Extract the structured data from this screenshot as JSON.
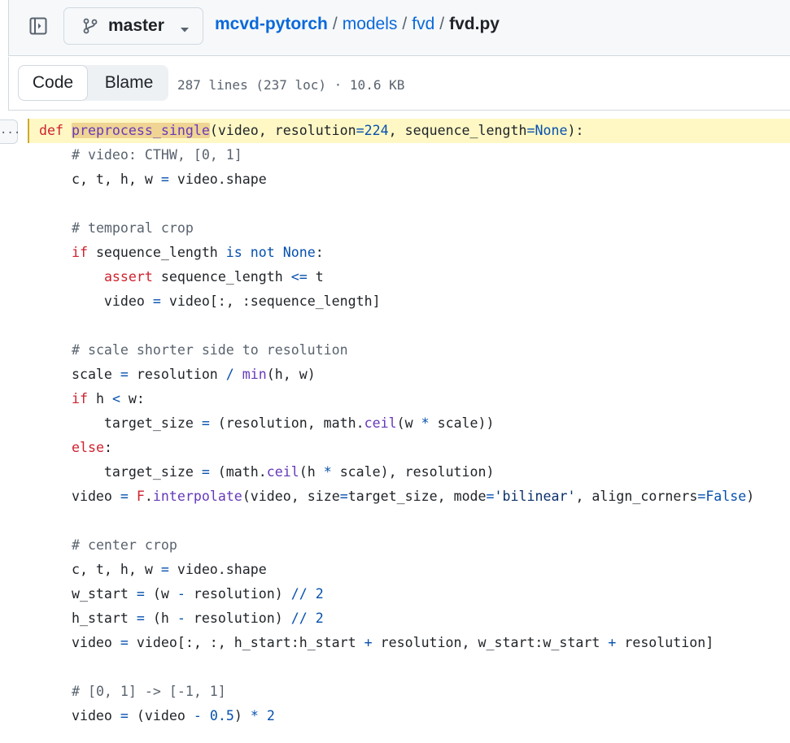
{
  "header": {
    "branch": "master",
    "breadcrumb": {
      "repo": "mcvd-pytorch",
      "dir1": "models",
      "dir2": "fvd",
      "file": "fvd.py",
      "separator": "/"
    }
  },
  "file_header": {
    "tab_code": "Code",
    "tab_blame": "Blame",
    "meta": "287 lines (237 loc) · 10.6 KB"
  },
  "code": {
    "expand_label": "...",
    "lines": [
      [
        {
          "t": "def",
          "c": "kw"
        },
        {
          "t": " "
        },
        {
          "t": "preprocess_single",
          "c": "fn hl-word"
        },
        {
          "t": "(video, resolution"
        },
        {
          "t": "=",
          "c": "nu"
        },
        {
          "t": "224",
          "c": "nu"
        },
        {
          "t": ", sequence_length"
        },
        {
          "t": "=",
          "c": "nu"
        },
        {
          "t": "None",
          "c": "nu"
        },
        {
          "t": "):"
        }
      ],
      [
        {
          "t": "    "
        },
        {
          "t": "# video: CTHW, [0, 1]",
          "c": "cm"
        }
      ],
      [
        {
          "t": "    c, t, h, w "
        },
        {
          "t": "=",
          "c": "nu"
        },
        {
          "t": " video.shape"
        }
      ],
      [
        {
          "t": ""
        }
      ],
      [
        {
          "t": "    "
        },
        {
          "t": "# temporal crop",
          "c": "cm"
        }
      ],
      [
        {
          "t": "    "
        },
        {
          "t": "if",
          "c": "kw"
        },
        {
          "t": " sequence_length "
        },
        {
          "t": "is not",
          "c": "nu"
        },
        {
          "t": " "
        },
        {
          "t": "None",
          "c": "nu"
        },
        {
          "t": ":"
        }
      ],
      [
        {
          "t": "        "
        },
        {
          "t": "assert",
          "c": "kw"
        },
        {
          "t": " sequence_length "
        },
        {
          "t": "<=",
          "c": "nu"
        },
        {
          "t": " t"
        }
      ],
      [
        {
          "t": "        video "
        },
        {
          "t": "=",
          "c": "nu"
        },
        {
          "t": " video[:, :sequence_length]"
        }
      ],
      [
        {
          "t": ""
        }
      ],
      [
        {
          "t": "    "
        },
        {
          "t": "# scale shorter side to resolution",
          "c": "cm"
        }
      ],
      [
        {
          "t": "    scale "
        },
        {
          "t": "=",
          "c": "nu"
        },
        {
          "t": " resolution "
        },
        {
          "t": "/",
          "c": "nu"
        },
        {
          "t": " "
        },
        {
          "t": "min",
          "c": "fn"
        },
        {
          "t": "(h, w)"
        }
      ],
      [
        {
          "t": "    "
        },
        {
          "t": "if",
          "c": "kw"
        },
        {
          "t": " h "
        },
        {
          "t": "<",
          "c": "nu"
        },
        {
          "t": " w:"
        }
      ],
      [
        {
          "t": "        target_size "
        },
        {
          "t": "=",
          "c": "nu"
        },
        {
          "t": " (resolution, math."
        },
        {
          "t": "ceil",
          "c": "fn"
        },
        {
          "t": "(w "
        },
        {
          "t": "*",
          "c": "nu"
        },
        {
          "t": " scale))"
        }
      ],
      [
        {
          "t": "    "
        },
        {
          "t": "else",
          "c": "kw"
        },
        {
          "t": ":"
        }
      ],
      [
        {
          "t": "        target_size "
        },
        {
          "t": "=",
          "c": "nu"
        },
        {
          "t": " (math."
        },
        {
          "t": "ceil",
          "c": "fn"
        },
        {
          "t": "(h "
        },
        {
          "t": "*",
          "c": "nu"
        },
        {
          "t": " scale), resolution)"
        }
      ],
      [
        {
          "t": "    video "
        },
        {
          "t": "=",
          "c": "nu"
        },
        {
          "t": " "
        },
        {
          "t": "F",
          "c": "kw"
        },
        {
          "t": "."
        },
        {
          "t": "interpolate",
          "c": "fn"
        },
        {
          "t": "(video, size"
        },
        {
          "t": "=",
          "c": "nu"
        },
        {
          "t": "target_size, mode"
        },
        {
          "t": "=",
          "c": "nu"
        },
        {
          "t": "'bilinear'",
          "c": "st"
        },
        {
          "t": ", align_corners"
        },
        {
          "t": "=",
          "c": "nu"
        },
        {
          "t": "False",
          "c": "nu"
        },
        {
          "t": ")"
        }
      ],
      [
        {
          "t": ""
        }
      ],
      [
        {
          "t": "    "
        },
        {
          "t": "# center crop",
          "c": "cm"
        }
      ],
      [
        {
          "t": "    c, t, h, w "
        },
        {
          "t": "=",
          "c": "nu"
        },
        {
          "t": " video.shape"
        }
      ],
      [
        {
          "t": "    w_start "
        },
        {
          "t": "=",
          "c": "nu"
        },
        {
          "t": " (w "
        },
        {
          "t": "-",
          "c": "nu"
        },
        {
          "t": " resolution) "
        },
        {
          "t": "//",
          "c": "nu"
        },
        {
          "t": " "
        },
        {
          "t": "2",
          "c": "nu"
        }
      ],
      [
        {
          "t": "    h_start "
        },
        {
          "t": "=",
          "c": "nu"
        },
        {
          "t": " (h "
        },
        {
          "t": "-",
          "c": "nu"
        },
        {
          "t": " resolution) "
        },
        {
          "t": "//",
          "c": "nu"
        },
        {
          "t": " "
        },
        {
          "t": "2",
          "c": "nu"
        }
      ],
      [
        {
          "t": "    video "
        },
        {
          "t": "=",
          "c": "nu"
        },
        {
          "t": " video[:, :, h_start:h_start "
        },
        {
          "t": "+",
          "c": "nu"
        },
        {
          "t": " resolution, w_start:w_start "
        },
        {
          "t": "+",
          "c": "nu"
        },
        {
          "t": " resolution]"
        }
      ],
      [
        {
          "t": ""
        }
      ],
      [
        {
          "t": "    "
        },
        {
          "t": "# [0, 1] -> [-1, 1]",
          "c": "cm"
        }
      ],
      [
        {
          "t": "    video "
        },
        {
          "t": "=",
          "c": "nu"
        },
        {
          "t": " (video "
        },
        {
          "t": "-",
          "c": "nu"
        },
        {
          "t": " "
        },
        {
          "t": "0.5",
          "c": "nu"
        },
        {
          "t": ") "
        },
        {
          "t": "*",
          "c": "nu"
        },
        {
          "t": " "
        },
        {
          "t": "2",
          "c": "nu"
        }
      ]
    ]
  },
  "colors": {
    "link": "#0969da",
    "keyword": "#cf222e",
    "function": "#6639ba",
    "constant": "#0550ae",
    "string": "#0a3069",
    "comment": "#59636e",
    "highlight_line": "#fff8c5",
    "highlight_word": "#f0d493"
  }
}
